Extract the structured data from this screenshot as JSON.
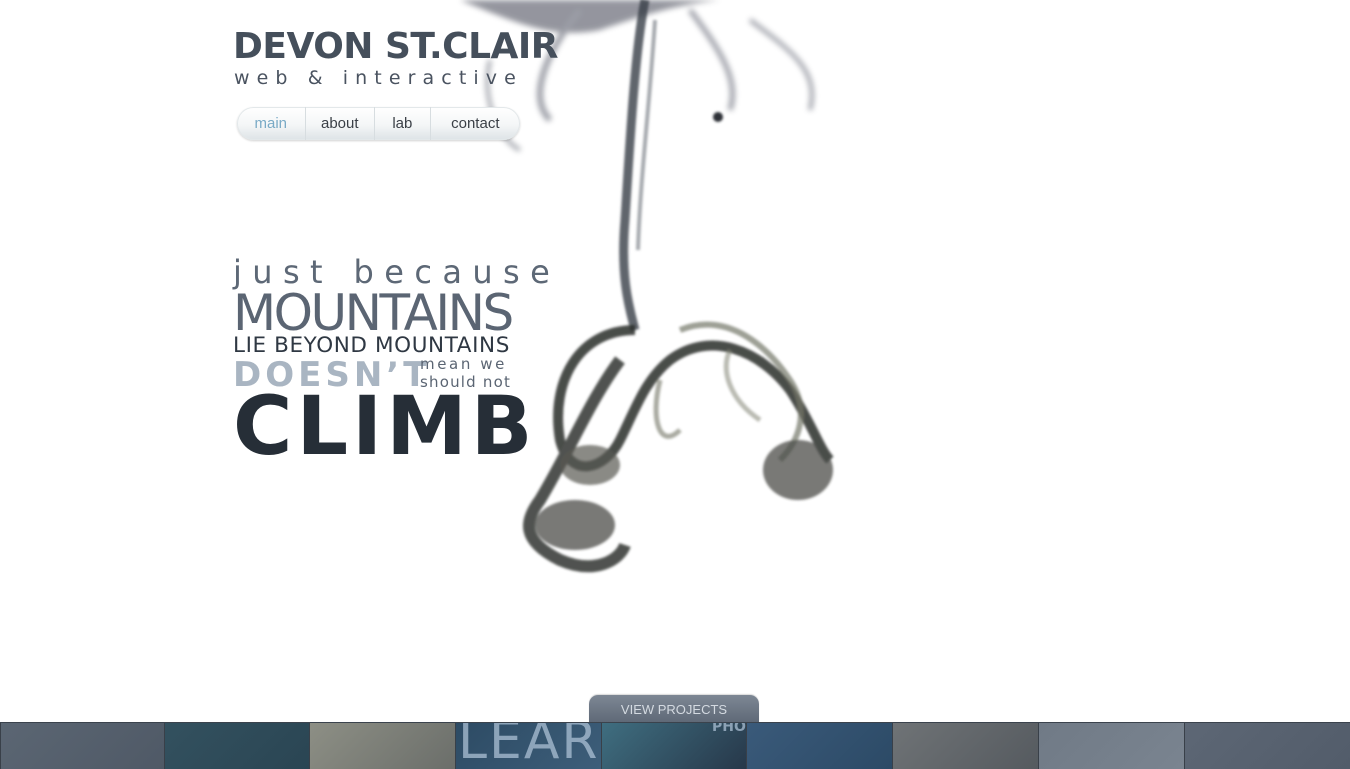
{
  "logo": {
    "title": "DEVON ST.CLAIR",
    "subtitle": "web & interactive"
  },
  "nav": {
    "items": [
      "main",
      "about",
      "lab",
      "contact"
    ],
    "active": "main",
    "active_color": "#79aac6"
  },
  "tagline": {
    "line1": "just because",
    "line2": "MOUNTAINS",
    "line3": "LIE BEYOND MOUNTAINS",
    "line4": "DOESN’T",
    "line5": "mean we",
    "line6": "should not",
    "line7": "CLIMB"
  },
  "view_projects_label": "VIEW PROJECTS",
  "project_strip": {
    "thumbnails": [
      {
        "name": "project-thumb-1",
        "colors": [
          "#5b6673",
          "#4f5966"
        ]
      },
      {
        "name": "project-thumb-2",
        "colors": [
          "#33515f",
          "#2a4553"
        ]
      },
      {
        "name": "project-thumb-3",
        "colors": [
          "#8d8f85",
          "#6b6e6a"
        ]
      },
      {
        "name": "project-thumb-4",
        "text": "LEAR",
        "colors": [
          "#2d4b64",
          "#3d5e7a"
        ]
      },
      {
        "name": "project-thumb-5",
        "text": "PHO",
        "colors": [
          "#3f6e80",
          "#27384a"
        ]
      },
      {
        "name": "project-thumb-6",
        "colors": [
          "#3a5a7a",
          "#2c4a66"
        ]
      },
      {
        "name": "project-thumb-7",
        "colors": [
          "#6f7376",
          "#555a5f"
        ]
      },
      {
        "name": "project-thumb-8",
        "colors": [
          "#707a86",
          "#7a8490"
        ]
      },
      {
        "name": "project-thumb-9",
        "colors": [
          "#5d6775",
          "#525c6a"
        ]
      }
    ]
  }
}
